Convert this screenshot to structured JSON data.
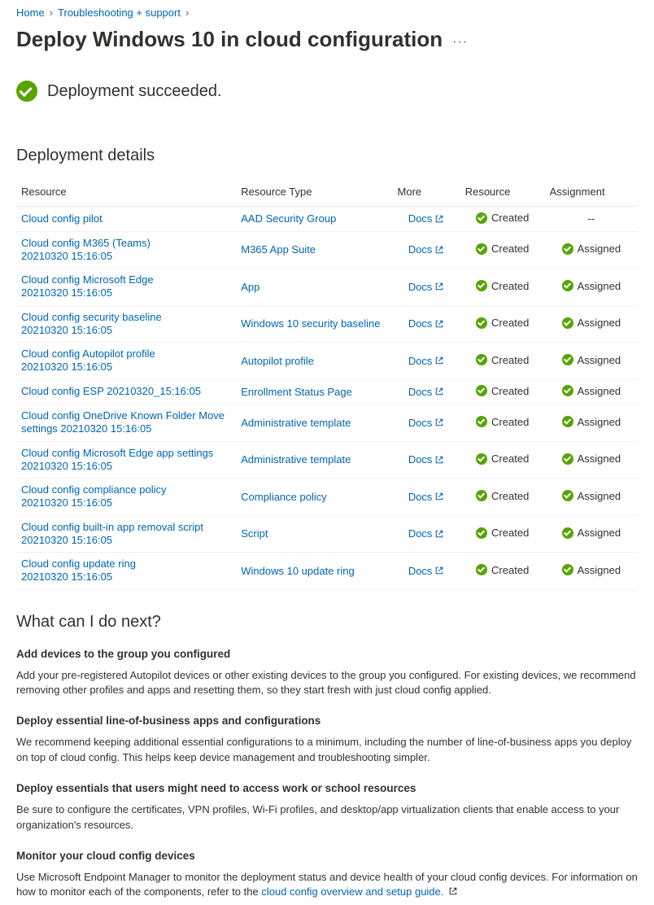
{
  "breadcrumb": {
    "home": "Home",
    "troubleshoot": "Troubleshooting + support"
  },
  "page": {
    "title": "Deploy Windows 10 in cloud configuration",
    "ellipsis": "···"
  },
  "status": {
    "message": "Deployment succeeded."
  },
  "details": {
    "heading": "Deployment details",
    "headers": {
      "resource": "Resource",
      "type": "Resource Type",
      "more": "More",
      "status": "Resource",
      "assignment": "Assignment"
    },
    "docs_label": "Docs",
    "created_label": "Created",
    "assigned_label": "Assigned",
    "no_assign": "--",
    "rows": [
      {
        "name": "Cloud config pilot",
        "sub": "",
        "type": "AAD Security Group",
        "assigned": false
      },
      {
        "name": "Cloud config M365 (Teams)",
        "sub": "20210320  15:16:05",
        "type": "M365 App Suite",
        "assigned": true
      },
      {
        "name": "Cloud config Microsoft Edge",
        "sub": "20210320  15:16:05",
        "type": "App",
        "assigned": true
      },
      {
        "name": "Cloud config security baseline",
        "sub": "20210320  15:16:05",
        "type": "Windows 10 security baseline",
        "assigned": true
      },
      {
        "name": "Cloud config Autopilot profile",
        "sub": "20210320  15:16:05",
        "type": "Autopilot profile",
        "assigned": true
      },
      {
        "name": "Cloud config ESP 20210320_15:16:05",
        "sub": "",
        "type": "Enrollment Status Page",
        "assigned": true
      },
      {
        "name": "Cloud config OneDrive Known Folder Move",
        "sub": "settings 20210320  15:16:05",
        "type": "Administrative template",
        "assigned": true
      },
      {
        "name": "Cloud config Microsoft Edge app settings",
        "sub": "20210320  15:16:05",
        "type": "Administrative template",
        "assigned": true
      },
      {
        "name": "Cloud config compliance policy",
        "sub": "20210320  15:16:05",
        "type": "Compliance policy",
        "assigned": true
      },
      {
        "name": "Cloud config built-in app removal script",
        "sub": "20210320  15:16:05",
        "type": "Script",
        "assigned": true
      },
      {
        "name": "Cloud config update ring",
        "sub": "20210320  15:16:05",
        "type": "Windows 10 update ring",
        "assigned": true
      }
    ]
  },
  "next": {
    "heading": "What can I do next?",
    "s1_title": "Add devices to the group you configured",
    "s1_body": "Add your pre-registered Autopilot devices or other existing devices to the group you configured. For existing devices, we recommend removing other profiles and apps and resetting them, so they start fresh with just cloud config applied.",
    "s2_title": "Deploy essential line-of-business apps and configurations",
    "s2_body": "We recommend keeping additional essential configurations to a minimum, including the number of line-of-business apps you deploy on top of cloud config. This helps keep device management and troubleshooting simpler.",
    "s3_title": "Deploy essentials that users might need to access work or school resources",
    "s3_body": "Be sure to configure the certificates, VPN profiles, Wi-Fi profiles, and desktop/app virtualization clients that enable access to your organization's resources.",
    "s4_title": "Monitor your cloud config devices",
    "s4_body_prefix": "Use Microsoft Endpoint Manager to monitor the deployment status and device health of your cloud config devices. For information on how to monitor each of the components, refer to the ",
    "s4_link": "cloud config overview and setup guide."
  }
}
